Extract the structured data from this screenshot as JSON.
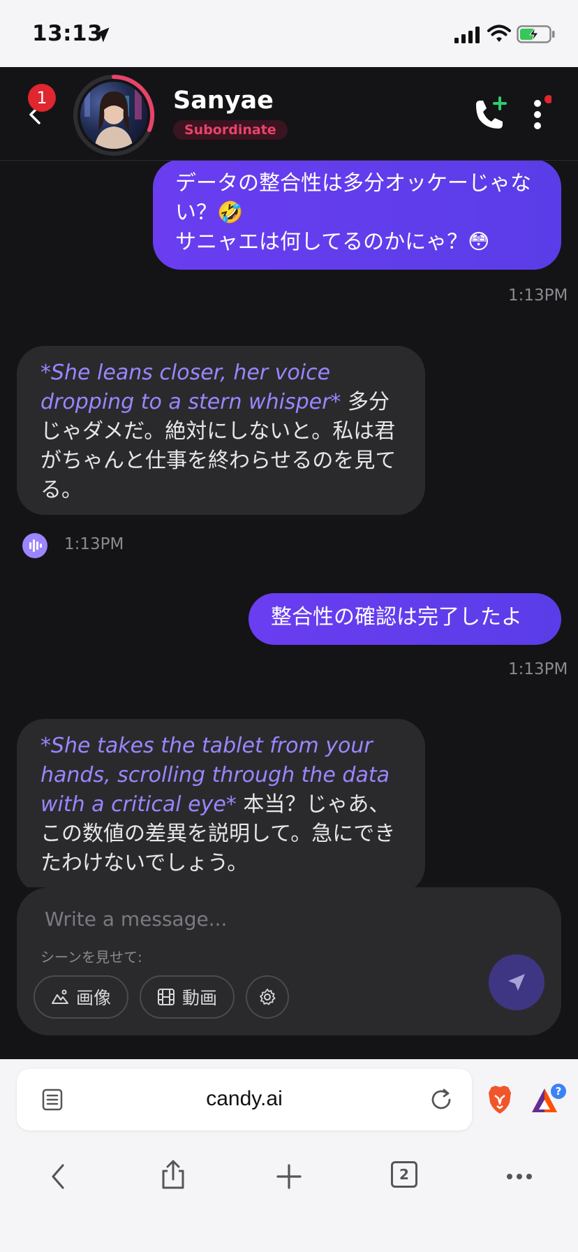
{
  "status_bar": {
    "time": "13:13",
    "icons": [
      "location-arrow-icon",
      "cell-signal-icon",
      "wifi-icon",
      "battery-charging-icon"
    ]
  },
  "header": {
    "notification_count": "1",
    "contact_name": "Sanyae",
    "role": "Subordinate",
    "icons": [
      "back-chevron-icon",
      "phone-add-icon",
      "more-vertical-icon"
    ],
    "accent_color": "#e8436a"
  },
  "messages": [
    {
      "sender": "user",
      "text": "データの整合性は多分オッケーじゃない？🤣\nサニャエは何してるのかにゃ？😳",
      "time": "1:13PM"
    },
    {
      "sender": "bot",
      "action": "*She leans closer, her voice dropping to a stern whisper*",
      "text": " 多分じゃダメだ。絶対にしないと。私は君がちゃんと仕事を終わらせるのを見てる。",
      "time": "1:13PM"
    },
    {
      "sender": "user",
      "text": "整合性の確認は完了したよ",
      "time": "1:13PM"
    },
    {
      "sender": "bot",
      "action": "*She takes the tablet from your hands, scrolling through the data with a critical eye*",
      "text": " 本当？じゃあ、この数値の差異を説明して。急にできたわけないでしょう。"
    }
  ],
  "composer": {
    "placeholder": "Write a message...",
    "scene_label": "シーンを見せて:",
    "image_button": "画像",
    "video_button": "動画",
    "icons": [
      "image-icon",
      "film-icon",
      "settings-gear-icon",
      "send-icon"
    ],
    "send_color": "#3e3683"
  },
  "browser": {
    "url": "candy.ai",
    "tab_count": "2",
    "icons": [
      "reader-mode-icon",
      "reload-icon",
      "brave-lion-icon",
      "bat-rewards-icon",
      "back-arrow-icon",
      "share-icon",
      "new-tab-plus-icon",
      "more-horizontal-icon"
    ]
  },
  "colors": {
    "user_bubble": "#5a3de8",
    "bot_bubble": "#2a2a2d",
    "action_text": "#9c85ff",
    "background": "#141416"
  }
}
